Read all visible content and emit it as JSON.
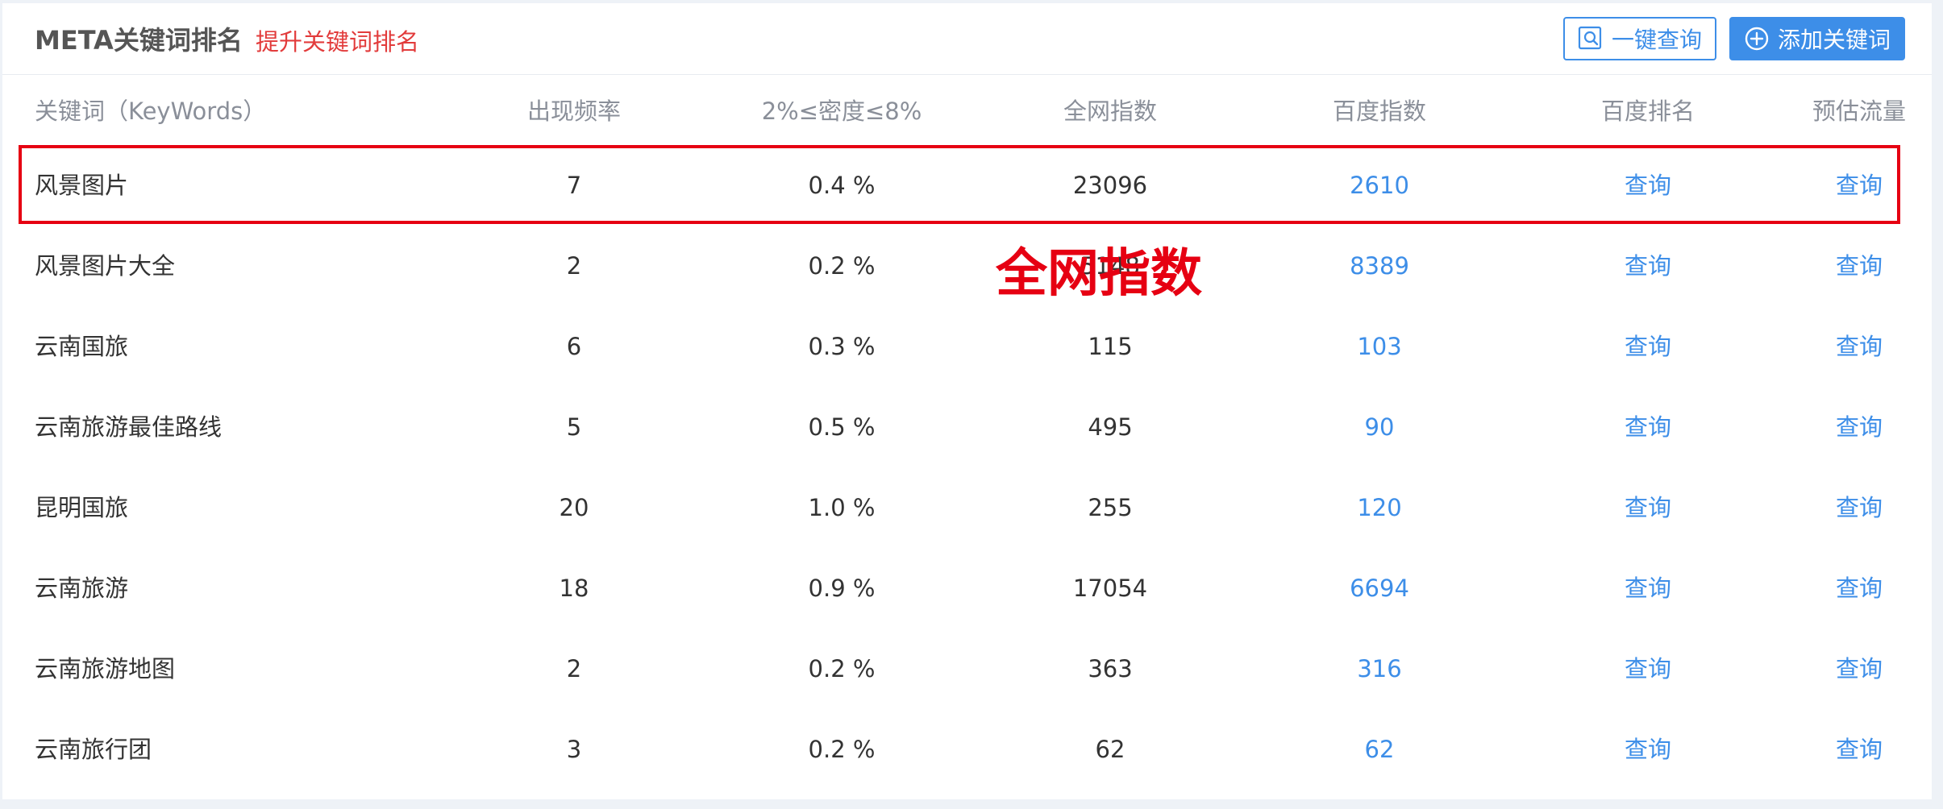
{
  "header": {
    "title": "META关键词排名",
    "subtitle": "提升关键词排名",
    "query_button": "一键查询",
    "add_button": "添加关键词"
  },
  "table": {
    "columns": [
      "关键词（KeyWords）",
      "出现频率",
      "2%≤密度≤8%",
      "全网指数",
      "百度指数",
      "百度排名",
      "预估流量"
    ],
    "rows": [
      {
        "keyword": "风景图片",
        "frequency": "7",
        "density": "0.4 %",
        "net_index": "23096",
        "baidu_index": "2610",
        "baidu_rank": "查询",
        "traffic": "查询"
      },
      {
        "keyword": "风景图片大全",
        "frequency": "2",
        "density": "0.2 %",
        "net_index": "5148",
        "baidu_index": "8389",
        "baidu_rank": "查询",
        "traffic": "查询"
      },
      {
        "keyword": "云南国旅",
        "frequency": "6",
        "density": "0.3 %",
        "net_index": "115",
        "baidu_index": "103",
        "baidu_rank": "查询",
        "traffic": "查询"
      },
      {
        "keyword": "云南旅游最佳路线",
        "frequency": "5",
        "density": "0.5 %",
        "net_index": "495",
        "baidu_index": "90",
        "baidu_rank": "查询",
        "traffic": "查询"
      },
      {
        "keyword": "昆明国旅",
        "frequency": "20",
        "density": "1.0 %",
        "net_index": "255",
        "baidu_index": "120",
        "baidu_rank": "查询",
        "traffic": "查询"
      },
      {
        "keyword": "云南旅游",
        "frequency": "18",
        "density": "0.9 %",
        "net_index": "17054",
        "baidu_index": "6694",
        "baidu_rank": "查询",
        "traffic": "查询"
      },
      {
        "keyword": "云南旅游地图",
        "frequency": "2",
        "density": "0.2 %",
        "net_index": "363",
        "baidu_index": "316",
        "baidu_rank": "查询",
        "traffic": "查询"
      },
      {
        "keyword": "云南旅行团",
        "frequency": "3",
        "density": "0.2 %",
        "net_index": "62",
        "baidu_index": "62",
        "baidu_rank": "查询",
        "traffic": "查询"
      }
    ]
  },
  "annotation": {
    "label": "全网指数"
  },
  "colors": {
    "accent": "#3d8ee8",
    "highlight": "#e60012",
    "subtitle": "#e23b3b"
  }
}
